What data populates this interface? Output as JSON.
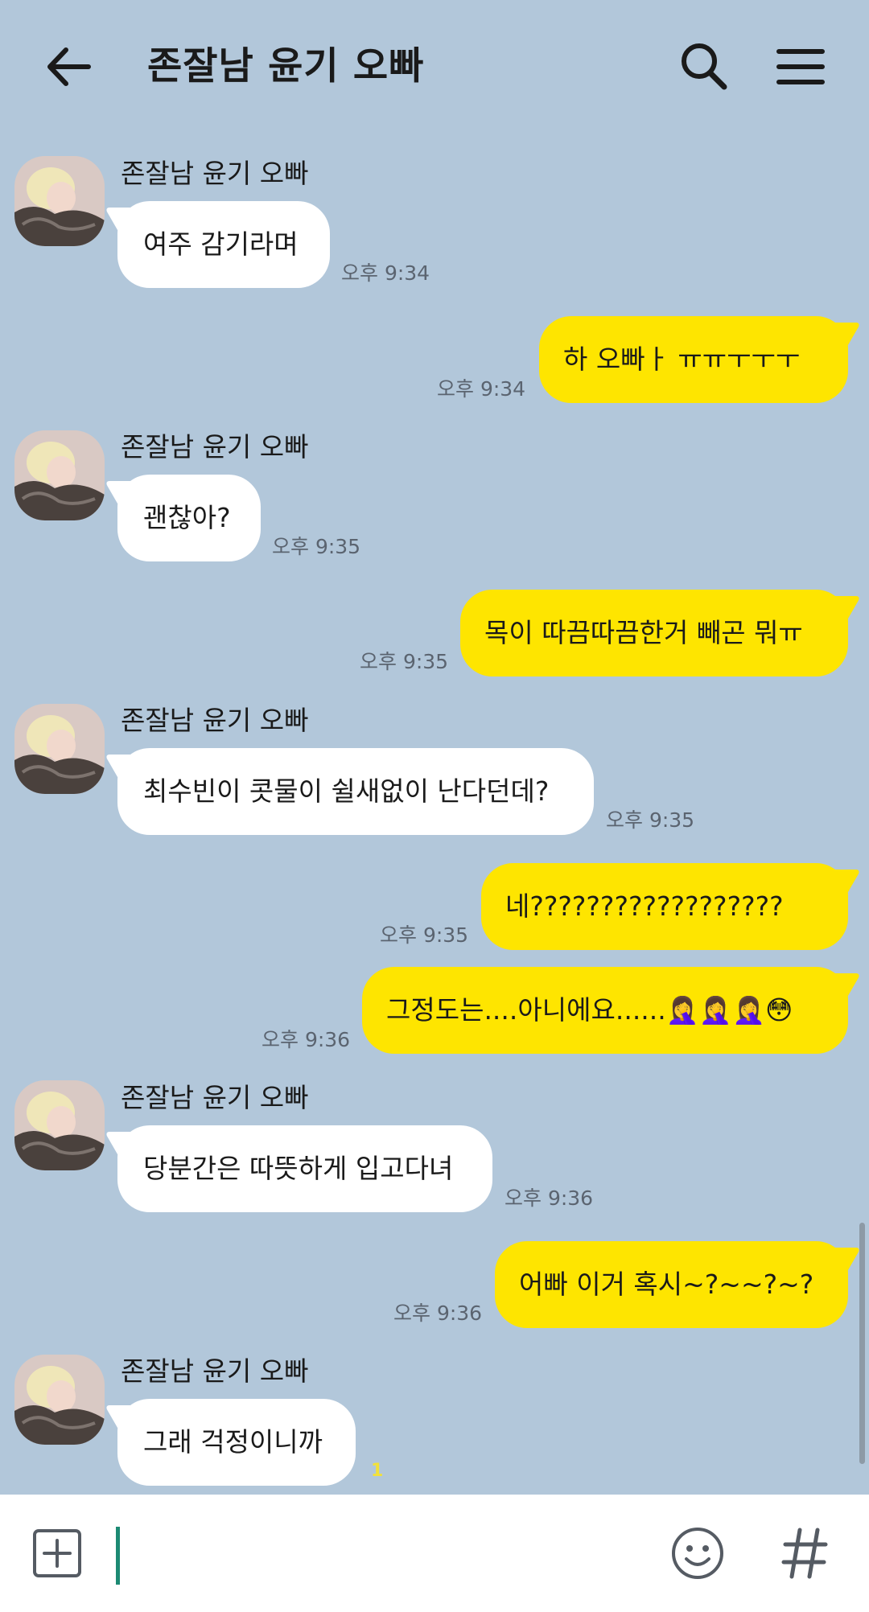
{
  "header": {
    "title": "존잘남 윤기 오빠",
    "icons": {
      "back": "arrow-left-icon",
      "search": "search-icon",
      "menu": "hamburger-menu-icon"
    }
  },
  "colors": {
    "background": "#b2c7da",
    "incoming_bubble": "#ffffff",
    "outgoing_bubble": "#fee500",
    "cursor": "#1c8a73"
  },
  "messages": [
    {
      "direction": "in",
      "sender": "존잘남 윤기 오빠",
      "text": "여주 감기라며",
      "time": "오후 9:34"
    },
    {
      "direction": "out",
      "text": "하 오빠ㅏ ㅠㅠㅜㅜㅜ",
      "time": "오후 9:34"
    },
    {
      "direction": "in",
      "sender": "존잘남 윤기 오빠",
      "text": "괜찮아?",
      "time": "오후 9:35"
    },
    {
      "direction": "out",
      "text": "목이 따끔따끔한거 빼곤 뭐ㅠ",
      "time": "오후 9:35"
    },
    {
      "direction": "in",
      "sender": "존잘남 윤기 오빠",
      "text": "최수빈이 콧물이 쉴새없이 난다던데?",
      "time": "오후 9:35"
    },
    {
      "direction": "out",
      "text": "네??????????????????",
      "time": "오후 9:35"
    },
    {
      "direction": "out",
      "text": "그정도는....아니에요......🤦‍♀️🤦‍♀️🤦‍♀️😳",
      "time": "오후 9:36"
    },
    {
      "direction": "in",
      "sender": "존잘남 윤기 오빠",
      "text": "당분간은 따뜻하게 입고다녀",
      "time": "오후 9:36"
    },
    {
      "direction": "out",
      "text": "어빠 이거 혹시~?~~?~?",
      "time": "오후 9:36"
    },
    {
      "direction": "in",
      "sender": "존잘남 윤기 오빠",
      "text": "그래 걱정이니까",
      "unread": "1"
    }
  ],
  "input_bar": {
    "placeholder": "",
    "icons": {
      "add": "plus-square-icon",
      "emoji": "smiley-icon",
      "hashtag": "hashtag-icon"
    }
  }
}
